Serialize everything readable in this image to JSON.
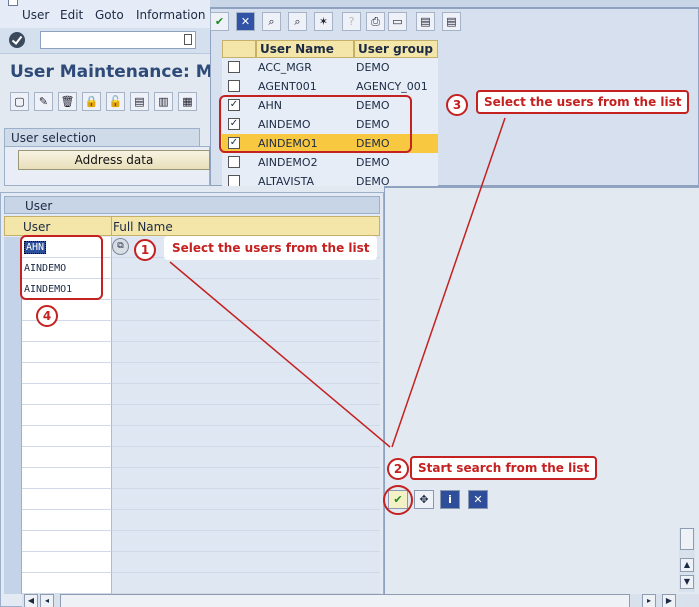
{
  "menu": {
    "items": [
      "User",
      "Edit",
      "Goto",
      "Information"
    ]
  },
  "page_title": "User Maintenance: Mas",
  "selection": {
    "tab_label": "User selection",
    "address_button": "Address data"
  },
  "table": {
    "title": "User",
    "headers": [
      "User",
      "Full Name"
    ],
    "rows": [
      "AHN",
      "AINDEMO",
      "AINDEMO1"
    ]
  },
  "popup": {
    "headers": [
      "User Name",
      "User group"
    ],
    "rows": [
      {
        "name": "ACC_MGR",
        "group": "DEMO",
        "checked": false
      },
      {
        "name": "AGENT001",
        "group": "AGENCY_001",
        "checked": false
      },
      {
        "name": "AHN",
        "group": "DEMO",
        "checked": true
      },
      {
        "name": "AINDEMO",
        "group": "DEMO",
        "checked": true
      },
      {
        "name": "AINDEMO1",
        "group": "DEMO",
        "checked": true
      },
      {
        "name": "AINDEMO2",
        "group": "DEMO",
        "checked": false
      },
      {
        "name": "ALTAVISTA",
        "group": "DEMO",
        "checked": false
      }
    ]
  },
  "annotations": {
    "n1": "1",
    "c1": "Select the users from the list",
    "n2": "2",
    "c2": "Start search from the list",
    "n3": "3",
    "c3": "Select the users from the list",
    "n4": "4"
  },
  "colors": {
    "annotation": "#c42121",
    "highlight_row": "#f8c840",
    "title": "#2d4a78"
  }
}
